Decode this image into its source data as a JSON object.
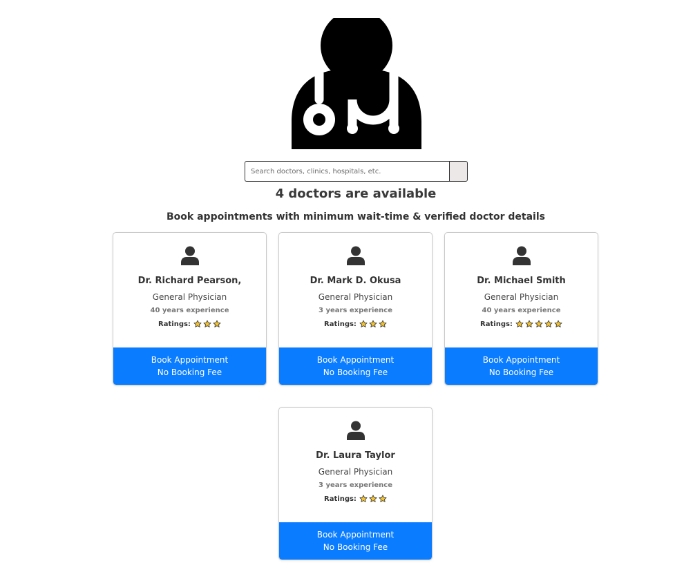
{
  "search": {
    "placeholder": "Search doctors, clinics, hospitals, etc."
  },
  "heading": {
    "count_text": "4 doctors are available",
    "subtitle": "Book appointments with minimum wait-time & verified doctor details"
  },
  "colors": {
    "accent": "#0a7cff",
    "star_fill": "#f2c230"
  },
  "icons": {
    "hero": "doctor-stethoscope-icon",
    "card_avatar": "user-icon",
    "rating": "star-icon"
  },
  "doctors": [
    {
      "name": "Dr. Richard Pearson,",
      "specialty": "General Physician",
      "experience": "40 years experience",
      "ratings_label": "Ratings:",
      "stars": 3,
      "button_line1": "Book Appointment",
      "button_line2": "No Booking Fee"
    },
    {
      "name": "Dr. Mark D. Okusa",
      "specialty": "General Physician",
      "experience": "3 years experience",
      "ratings_label": "Ratings:",
      "stars": 3,
      "button_line1": "Book Appointment",
      "button_line2": "No Booking Fee"
    },
    {
      "name": "Dr. Michael Smith",
      "specialty": "General Physician",
      "experience": "40 years experience",
      "ratings_label": "Ratings:",
      "stars": 5,
      "button_line1": "Book Appointment",
      "button_line2": "No Booking Fee"
    },
    {
      "name": "Dr. Laura Taylor",
      "specialty": "General Physician",
      "experience": "3 years experience",
      "ratings_label": "Ratings:",
      "stars": 3,
      "button_line1": "Book Appointment",
      "button_line2": "No Booking Fee"
    }
  ]
}
